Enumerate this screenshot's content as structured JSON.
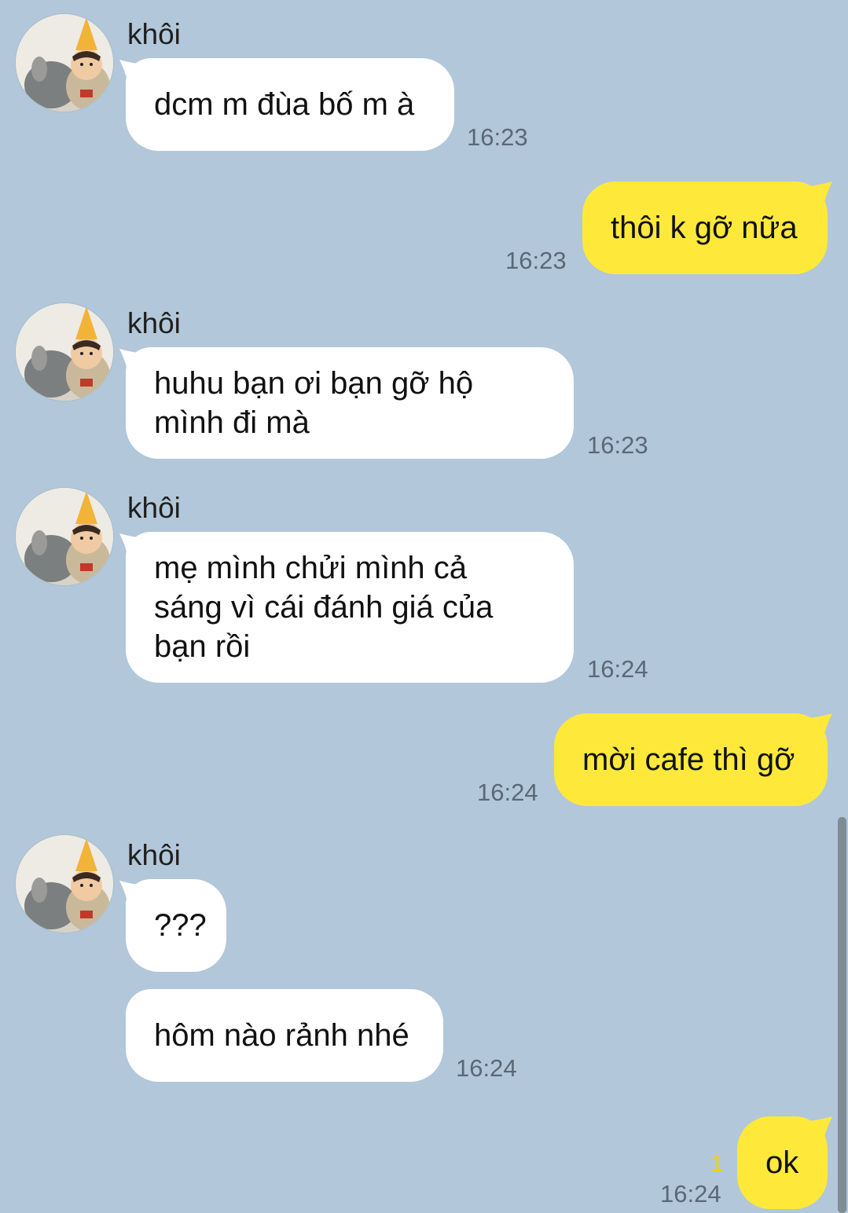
{
  "contact": {
    "name": "khôi",
    "avatar_icon": "child-with-party-hat-avatar-icon"
  },
  "messages": [
    {
      "from": "them",
      "text": "dcm m đùa bố m à",
      "time": "16:23"
    },
    {
      "from": "me",
      "text": "thôi k gỡ nữa",
      "time": "16:23"
    },
    {
      "from": "them",
      "text": "huhu bạn ơi bạn gỡ hộ\nmình đi mà",
      "time": "16:23"
    },
    {
      "from": "them",
      "text": "mẹ mình chửi mình cả\nsáng vì cái đánh giá của\nbạn rồi",
      "time": "16:24"
    },
    {
      "from": "me",
      "text": "mời cafe thì gỡ",
      "time": "16:24"
    },
    {
      "from": "them",
      "text": "???",
      "time": ""
    },
    {
      "from": "them",
      "text": "hôm nào rảnh nhé",
      "time": "16:24"
    },
    {
      "from": "me",
      "text": "ok",
      "time": "16:24",
      "unread_count": "1"
    }
  ],
  "colors": {
    "background": "#b2c7d9",
    "incoming_bubble": "#ffffff",
    "outgoing_bubble": "#fee93b",
    "unread": "#f5d000"
  }
}
